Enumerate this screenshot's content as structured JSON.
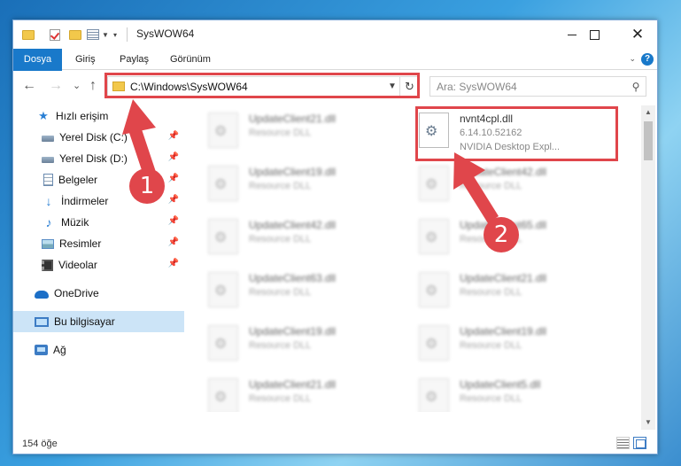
{
  "window": {
    "title": "SysWOW64",
    "controls": {
      "minimize": "",
      "maximize": "",
      "close": "✕"
    }
  },
  "ribbon": {
    "tabs": [
      "Dosya",
      "Giriş",
      "Paylaş",
      "Görünüm"
    ],
    "help": "?"
  },
  "nav": {
    "back": "←",
    "forward": "→",
    "recent": "⌄",
    "up": "↑",
    "address": "C:\\Windows\\SysWOW64",
    "refresh": "↻",
    "search_placeholder": "Ara: SysWOW64",
    "search_icon": "⚲"
  },
  "sidebar": {
    "items": [
      {
        "label": "Hızlı erişim",
        "icon": "star-icon"
      },
      {
        "label": "Yerel Disk (C:)",
        "icon": "drive-icon",
        "pinned": true
      },
      {
        "label": "Yerel Disk (D:)",
        "icon": "drive-icon",
        "pinned": true
      },
      {
        "label": "Belgeler",
        "icon": "documents-icon",
        "pinned": true
      },
      {
        "label": "İndirmeler",
        "icon": "downloads-icon",
        "pinned": true
      },
      {
        "label": "Müzik",
        "icon": "music-icon",
        "pinned": true
      },
      {
        "label": "Resimler",
        "icon": "pictures-icon",
        "pinned": true
      },
      {
        "label": "Videolar",
        "icon": "videos-icon",
        "pinned": true
      },
      {
        "label": "OneDrive",
        "icon": "cloud-icon"
      },
      {
        "label": "Bu bilgisayar",
        "icon": "computer-icon",
        "selected": true
      },
      {
        "label": "Ağ",
        "icon": "network-icon"
      }
    ],
    "pin_glyph": "📌"
  },
  "files": {
    "left_column": [
      {
        "name": "UpdateClient21.dll",
        "type": "Resource DLL"
      },
      {
        "name": "UpdateClient19.dll",
        "type": "Resource DLL"
      },
      {
        "name": "UpdateClient42.dll",
        "type": "Resource DLL"
      },
      {
        "name": "UpdateClient63.dll",
        "type": "Resource DLL"
      },
      {
        "name": "UpdateClient19.dll",
        "type": "Resource DLL"
      },
      {
        "name": "UpdateClient21.dll",
        "type": "Resource DLL"
      }
    ],
    "highlighted": {
      "name": "nvnt4cpl.dll",
      "version": "6.14.10.52162",
      "description": "NVIDIA Desktop Expl..."
    },
    "right_column": [
      {
        "name": "UpdateClient42.dll",
        "type": "Resource DLL"
      },
      {
        "name": "UpdateClient65.dll",
        "type": "Resource DLL"
      },
      {
        "name": "UpdateClient21.dll",
        "type": "Resource DLL"
      },
      {
        "name": "UpdateClient19.dll",
        "type": "Resource DLL"
      },
      {
        "name": "UpdateClient5.dll",
        "type": "Resource DLL"
      }
    ]
  },
  "status": {
    "count": "154 öğe"
  },
  "annotations": {
    "step1": "1",
    "step2": "2",
    "color": "#e0464b"
  },
  "scrollbar": {
    "up": "▲",
    "down": "▼"
  }
}
